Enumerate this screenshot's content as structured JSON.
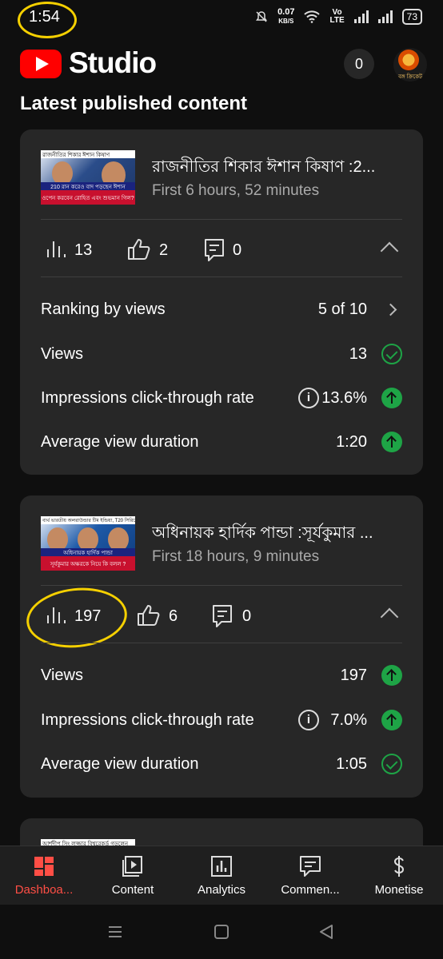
{
  "status_bar": {
    "time": "1:54",
    "net_speed_value": "0.07",
    "net_speed_unit": "KB/S",
    "volte_top": "Vo",
    "volte_bottom": "LTE",
    "battery": "73"
  },
  "app_bar": {
    "logo_text": "Studio",
    "notification_count": "0",
    "avatar_text": "বঙ্গ ক্রিকেট"
  },
  "section_title": "Latest published content",
  "cards": [
    {
      "thumbnail_text_top": "রাজনীতির শিকার ঈশান কিষাণ",
      "thumbnail_text_mid": "210 রান করেও বাদ পড়ছেন ঈশান",
      "thumbnail_text_bottom": "ওপেন করবেন রোহিত এবং শুভমান গিল?",
      "title": "রাজনীতির শিকার ঈশান কিষাণ :2...",
      "subtitle": "First 6 hours, 52 minutes",
      "views": "13",
      "likes": "2",
      "comments": "0",
      "stats": [
        {
          "label": "Ranking by views",
          "value": "5 of 10",
          "icon": "chevron-right-icon"
        },
        {
          "label": "Views",
          "value": "13",
          "icon": "check-circle-icon"
        },
        {
          "label": "Impressions click-through rate",
          "value": "13.6%",
          "icon": "arrow-up-icon"
        },
        {
          "label": "Average view duration",
          "value": "1:20",
          "icon": "arrow-up-icon"
        }
      ]
    },
    {
      "thumbnail_text_top": "ব্যর্থ ভারতীয় অলরাউন্ডার টিম ইন্ডিয়া, T20 সিরিজে জিতছে",
      "thumbnail_text_mid": "অধিনায়ক হার্দিক পান্ডা",
      "thumbnail_text_bottom": "সূর্যকুমার অক্ষরকে নিয়ে কি বলল ?",
      "title": "অধিনায়ক হার্দিক পান্ডা :সূর্যকুমার ...",
      "subtitle": "First 18 hours, 9 minutes",
      "views": "197",
      "likes": "6",
      "comments": "0",
      "stats": [
        {
          "label": "Views",
          "value": "197",
          "icon": "arrow-up-icon"
        },
        {
          "label": "Impressions click-through rate",
          "value": "7.0%",
          "icon": "arrow-up-icon"
        },
        {
          "label": "Average view duration",
          "value": "1:05",
          "icon": "check-circle-icon"
        }
      ]
    },
    {
      "thumbnail_text_top": "আর্শদীপ সিং লজ্জার বিশ্বরেকর্ড গড়লেন"
    }
  ],
  "bottom_nav": [
    {
      "label": "Dashboa...",
      "icon": "dashboard-icon",
      "active": true
    },
    {
      "label": "Content",
      "icon": "content-icon",
      "active": false
    },
    {
      "label": "Analytics",
      "icon": "analytics-icon",
      "active": false
    },
    {
      "label": "Commen...",
      "icon": "comments-icon",
      "active": false
    },
    {
      "label": "Monetise",
      "icon": "dollar-icon",
      "active": false
    }
  ],
  "colors": {
    "accent_red": "#ff4e45",
    "positive_green": "#1ea446",
    "annotation_yellow": "#f5d000",
    "card_bg": "#272727",
    "page_bg": "#0f0f0f"
  }
}
